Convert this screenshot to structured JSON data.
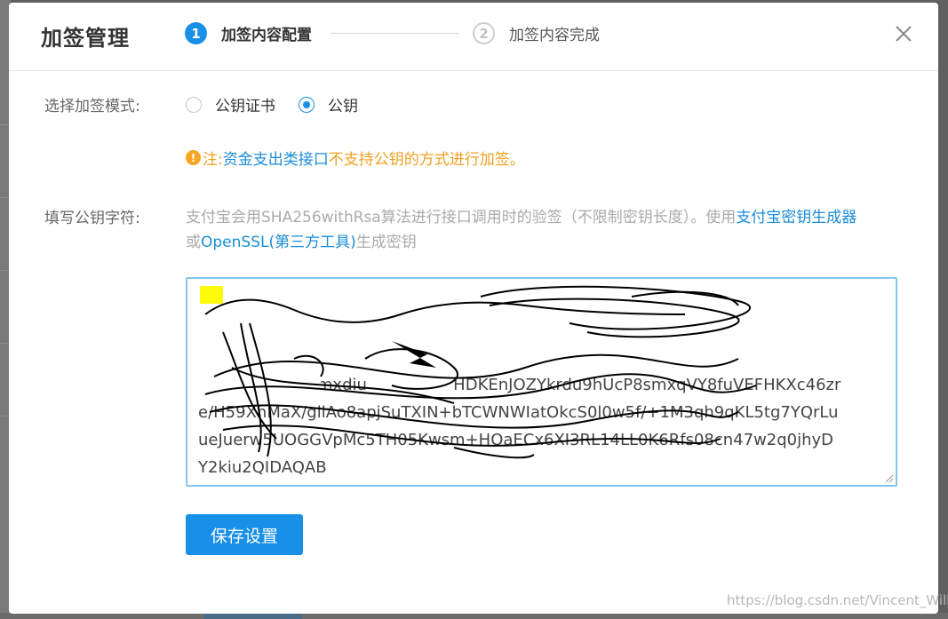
{
  "dialog": {
    "title": "加签管理",
    "steps": [
      {
        "number": "1",
        "label": "加签内容配置",
        "active": true
      },
      {
        "number": "2",
        "label": "加签内容完成",
        "active": false
      }
    ],
    "close_icon": "close-icon"
  },
  "mode": {
    "label": "选择加签模式:",
    "options": [
      {
        "label": "公钥证书",
        "checked": false
      },
      {
        "label": "公钥",
        "checked": true
      }
    ]
  },
  "notice": {
    "icon": "!",
    "prefix": "注:",
    "link": "资金支出类接口",
    "suffix": "不支持公钥的方式进行加签。"
  },
  "public_key": {
    "label": "填写公钥字符:",
    "desc_1": "支付宝会用SHA256withRsa算法进行接口调用时的验签（不限制密钥长度）。使用",
    "link_1": "支付宝密钥生成器",
    "desc_2": "或",
    "link_2": "OpenSSL(第三方工具)",
    "desc_3": "生成密钥",
    "value": "                                       Sev7rdVVvUaD\nP7Xw1tjc                                      gKOOEnJDbAAu0apeQow\nFx96r                                         dmnhJKMGaNDIJYk7p4rcgH\nUlIMd93DA    Kmxdiu                 HDKEnJOZYkrdu9hUcP8smxqVY8fuVEFHKXc46zr\ne/H59XhMaX/gllAo8apjSuTXIN+bTCWNWIatOkcS0l0w5f/+1M3qh9qKL5tg7YQrLu\nueJuerw5UOGGVpMc5TH05Kwsm+HOaECx6XI3RL14LL0K6Rfs08cn47w2q0jhyD\nY2kiu2QIDAQAB"
  },
  "save_button": "保存设置",
  "watermark": "https://blog.csdn.net/Vincent_Wilk",
  "colors": {
    "primary": "#1890e8",
    "warning": "#f0a020",
    "link": "#1a8cd8"
  }
}
